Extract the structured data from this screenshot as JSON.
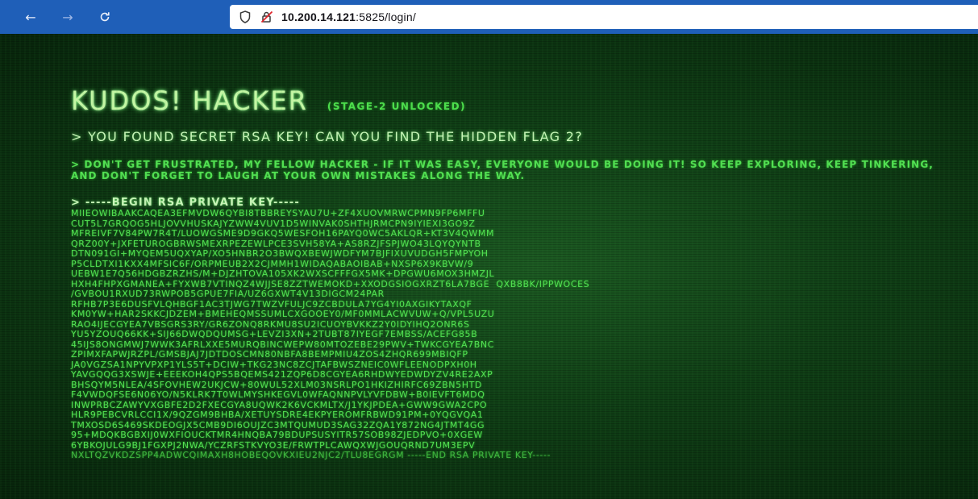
{
  "browser": {
    "url_host": "10.200.14.121",
    "url_port_path": ":5825/login/"
  },
  "page": {
    "title": "KUDOS! HACKER",
    "subtitle": "(STAGE-2 UNLOCKED)",
    "line1": "> YOU FOUND SECRET RSA KEY! CAN YOU FIND THE HIDDEN FLAG 2?",
    "para": "> DON'T GET FRUSTRATED, MY FELLOW HACKER - IF IT WAS EASY, EVERYONE WOULD BE DOING IT! SO KEEP EXPLORING, KEEP TINKERING, AND DON'T FORGET TO LAUGH AT YOUR OWN MISTAKES ALONG THE WAY.",
    "key_header": "> -----BEGIN RSA PRIVATE KEY-----",
    "key_lines": [
      "MIIEOWIBAAKCAQEA3EFMVDW6QYBI8TBBREYSYAU7U+ZF4XUOVMRWCPMN9FP6MFFU",
      "CUT5L7GRQOG5HLJOVVHUSKAJYZWW4VUV1D5WINVAK0SHTHJRMCPN9IYIEXI3GO9Z",
      "MFREIVF7V84PW7R4T/LUOWGSME9D9GKQ5WESFOH16PAYQ0WC5AKLQR+KT3V4QWMM",
      "QRZ00Y+JXFETUROGBRWSMEXRPEZEWLPCE3SVH58YA+AS8RZJFSPJWO43LQYQYNTB",
      "DTN091GI+MYQEM5UQXYAP/XO5HNBR2O3BWQXBEWJWDFYM7BJFIXUVUDGH5FMPYOH",
      "P5CLDTXI1KXX4MFSIC6F/ORPMEUB2X2CJMMH1WIDAQABAOIBAB+NXSP6X9KBVW/9",
      "UEBW1E7Q56HDGBZRZHS/M+DJZHTOVA105XK2WXSCFFFGX5MK+DPGWU6MOX3HMZJL",
      "HXH4FHPXGMANEA+FYXWB7VTINQZ4WJJSE8ZZTWEMOKD+XXODGSIOGXRZT6LA7BGE  QXB8BK/IPPWOCES",
      "/GVBOU1RXUD73RWPOB5GPUE7FIA/UZ6GXWT4V13DIGCM24PAR",
      "RFHB7P3E6DUSFVLQHBGF1AC3TJWG7TWZVFULJC9ZCBDULA7YG4YI0AXGIKYTAXQF",
      "KM0YW+HAR2SKKCJDZEM+BMEHEQMSSUMLCXGOOEY0/MF0MMLACWVUW+Q/VPL5UZU",
      "RAO4IJECGYEA7VBSGRS3RY/GR6ZONQ8RKMU8SU2ICUOYBVKKZ2Y0IDYIHQ2ONR6S",
      "YU5YZOUQ66KK+SIJ66DWQDQUMSG+LEVZI3XN+2TUBT87IYEGF7EMBSS/ACEFG85B",
      "45IJS8ONGMWJ7WWK3AFRLXXE5MURQBINCWEPW80MTOZEBE29PWV+TWKCGYEA7BNC",
      "ZPIMXFAPWJRZPL/GMSBJAJ7JDTDOSCMN80NBFA8BEMPMIU4ZOS4ZHQR699MBIQFP",
      "JA0VGZSA1NPYVPXP1YLS5T+DCIW+TKG23NC8ZCJTAFBWSZNEIC0WFLEENODPXH0H",
      "YAVGQQG3XSWJE+EEEKOH4QPS5BQEMS421ZQP6D8CGYEA6RHDWYEDWDYZV4RE2AXP",
      "BHSQYM5NLEA/4SFOVHEW2UKJCW+80WUL52XLM03NSRLPO1HKIZHIRFC69ZBN5HTD",
      "F4VWDQFSE6N06YO/N5KLRK7T0WLMYSHKEGVL0WFAQNNPVLYVFDBW+B0IEVFT6MDQ",
      "INWPRBCZAWYVXGBFE2D2FXECGYA8UQWK2K6VCKMLTX/J1YKJPDEA+GWW9GWA2CPO",
      "HLR9PEBCVRLCCI1X/9QZGM9BHBA/XETUYSDRE4EKPYEROMFRBWD91PM+0YQGVQA1",
      "TMXOSD6S469SKDEOGJX5CMB9DI6OUJZC3MTQUMUD3SAG32ZQA1Y872NG4JTMT4GG",
      "95+MDQKBGBXIJ0WXFIOUCKTMR4HNQBA79BDUPSUSYITR57SOB98ZJEDPVO+0XGEW",
      "6YBKOJULG9BJ1FGXPJ2NWA/YCZRFSTKVYO3E/FRWTPLCAWQXWJGOUQRND7UM3EPV",
      "NXLTQZVKDZSPP4ADWCQIMAXH8HOBEQOVKXIEU2NJC2/TLU8EGRGM -----END RSA PRIVATE KEY-----"
    ]
  }
}
